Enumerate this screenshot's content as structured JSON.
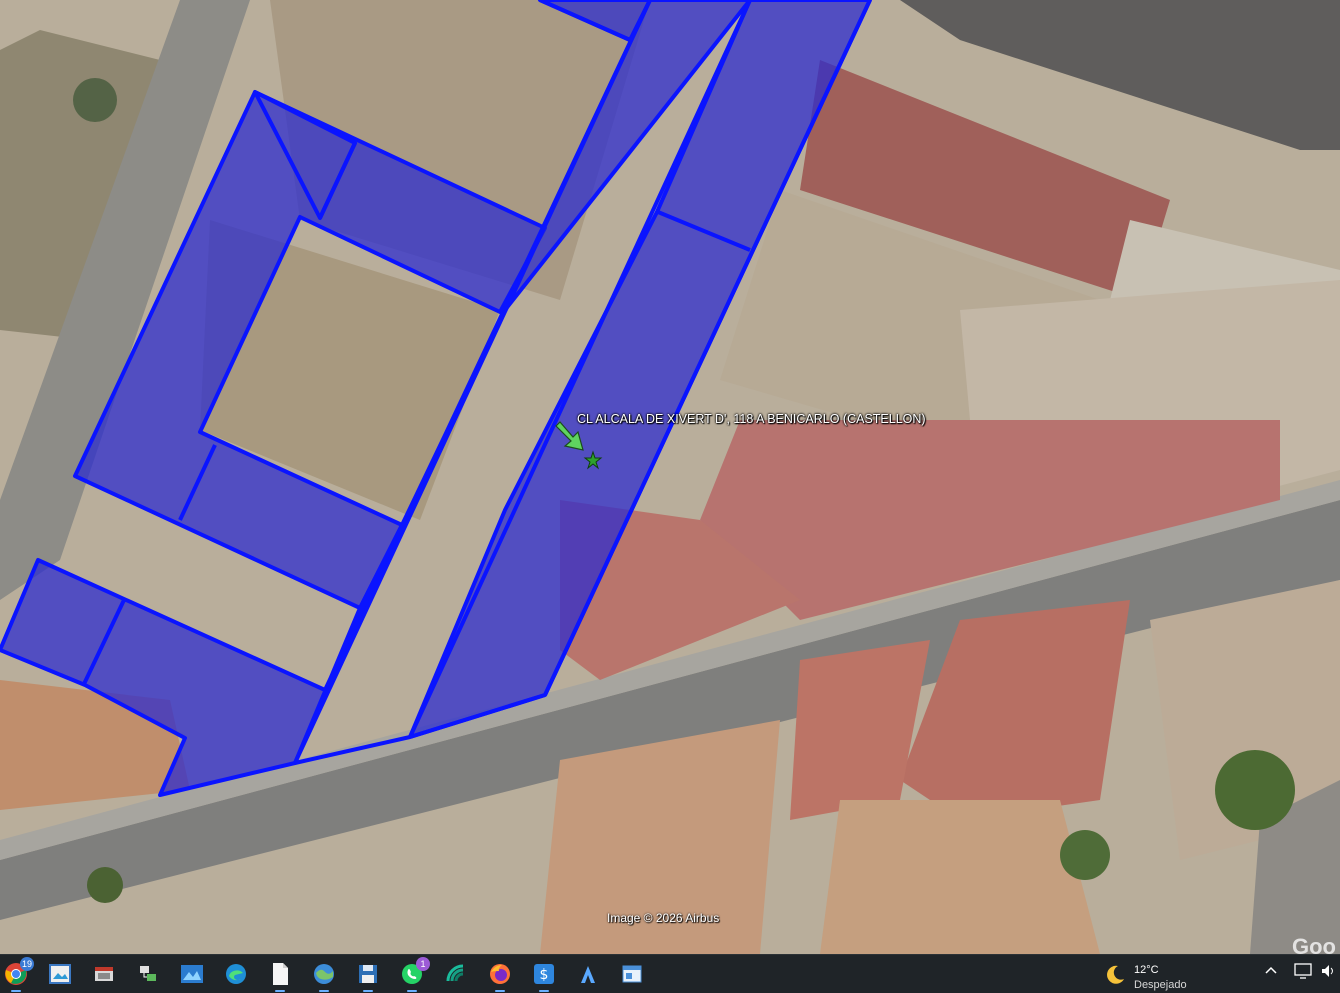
{
  "map": {
    "placemark_label": "CL ALCALA DE XIVERT D', 118 A BENICARLO (CASTELLON)",
    "attribution": "Image © 2026 Airbus",
    "watermark": "Goo",
    "parcel_fill_color": "#2a2ad0",
    "parcel_outline_color": "#0a14ff",
    "placemark_arrow_color": "#5fd35f"
  },
  "taskbar": {
    "apps": [
      {
        "name": "chrome-icon",
        "badge": "19"
      },
      {
        "name": "photos-icon"
      },
      {
        "name": "explorer-icon"
      },
      {
        "name": "network-manager-icon"
      },
      {
        "name": "image-viewer-icon"
      },
      {
        "name": "edge-icon"
      },
      {
        "name": "notepad-icon"
      },
      {
        "name": "google-earth-icon"
      },
      {
        "name": "save-disk-icon"
      },
      {
        "name": "whatsapp-icon",
        "badge": "1"
      },
      {
        "name": "wifi-analyzer-icon"
      },
      {
        "name": "firefox-icon"
      },
      {
        "name": "app-s-icon"
      },
      {
        "name": "app-a-icon"
      },
      {
        "name": "window-app-icon"
      }
    ],
    "weather": {
      "temperature": "12°C",
      "condition": "Despejado"
    },
    "tray_icons": [
      "chevron-up-icon",
      "network-icon",
      "volume-icon"
    ]
  }
}
